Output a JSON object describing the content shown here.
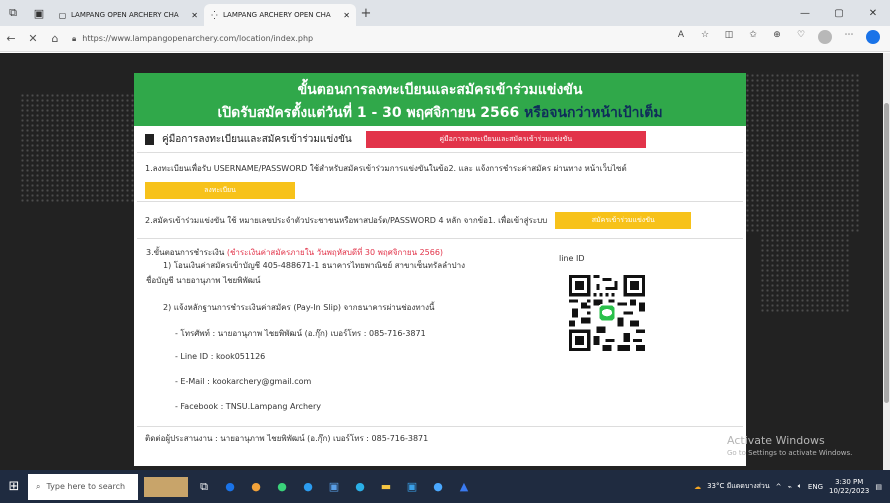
{
  "browser": {
    "tabs": [
      {
        "title": "LAMPANG OPEN ARCHERY CHA"
      },
      {
        "title": "LAMPANG ARCHERY OPEN CHA"
      }
    ],
    "url": "https://www.lampangopenarchery.com/location/index.php"
  },
  "modal": {
    "header_line1": "ขั้นตอนการลงทะเบียนและสมัครเข้าร่วมแข่งขัน",
    "header_line2_a": "เปิดรับสมัครตั้งแต่วันที่ 1 - 30 พฤศจิกายน 2566",
    "header_line2_b": "หรือจนกว่าหน้าเป้าเต็ม",
    "manual_title": "คู่มือการลงทะเบียนและสมัครเข้าร่วมแข่งขัน",
    "manual_button": "คู่มือการลงทะเบียนและสมัครเข้าร่วมแข่งขัน",
    "step1_text": "1.ลงทะเบียนเพื่อรับ USERNAME/PASSWORD ใช้สำหรับสมัครเข้าร่วมการแข่งขันในข้อ2. และ แจ้งการชำระค่าสมัคร ผ่านทาง หน้าเว็บไซต์",
    "step1_button": "ลงทะเบียน",
    "step2_text": "2.สมัครเข้าร่วมแข่งขัน ใช้ หมายเลขประจำตัวประชาชนหรือพาสปอร์ต/PASSWORD 4 หลัก จากข้อ1. เพื่อเข้าสู่ระบบ",
    "step2_button": "สมัครเข้าร่วมแข่งขัน",
    "step3_title": "3.ขั้นตอนการชำระเงิน",
    "step3_deadline": "(ชำระเงินค่าสมัครภายใน วันพฤหัสบดีที่ 30 พฤศจิกายน 2566)",
    "step3_line1": "1) โอนเงินค่าสมัครเข้าบัญชี 405-488671-1 ธนาคารไทยพาณิชย์ สาขาเซ็นทรัลลำปาง",
    "step3_line2": "ชื่อบัญชี นายอานุภาพ ไชยพิพัฒน์",
    "step3_line3": "2) แจ้งหลักฐานการชำระเงินค่าสมัคร (Pay-In Slip) จากธนาคารผ่านช่องทางนี้",
    "contact_phone": "- โทรศัพท์ : นายอานุภาพ ไชยพิพัฒน์ (อ.กุ๊ก) เบอร์โทร : 085-716-3871",
    "contact_line": "- Line ID : kook051126",
    "contact_email": "- E-Mail : kookarchery@gmail.com",
    "contact_facebook": "- Facebook : TNSU.Lampang Archery",
    "line_id_label": "line ID",
    "footer": "ติดต่อผู้ประสานงาน : นายอานุภาพ ไชยพิพัฒน์ (อ.กุ๊ก) เบอร์โทร : 085-716-3871"
  },
  "watermark": {
    "line1": "Activate Windows",
    "line2": "Go to Settings to activate Windows."
  },
  "taskbar": {
    "search_placeholder": "Type here to search",
    "weather": "33°C มีแดดบางส่วน",
    "lang": "ENG",
    "time": "3:30 PM",
    "date": "10/22/2023"
  },
  "colors": {
    "header_green": "#30a84a",
    "button_red": "#e2344a",
    "button_yellow": "#f7c21a"
  }
}
